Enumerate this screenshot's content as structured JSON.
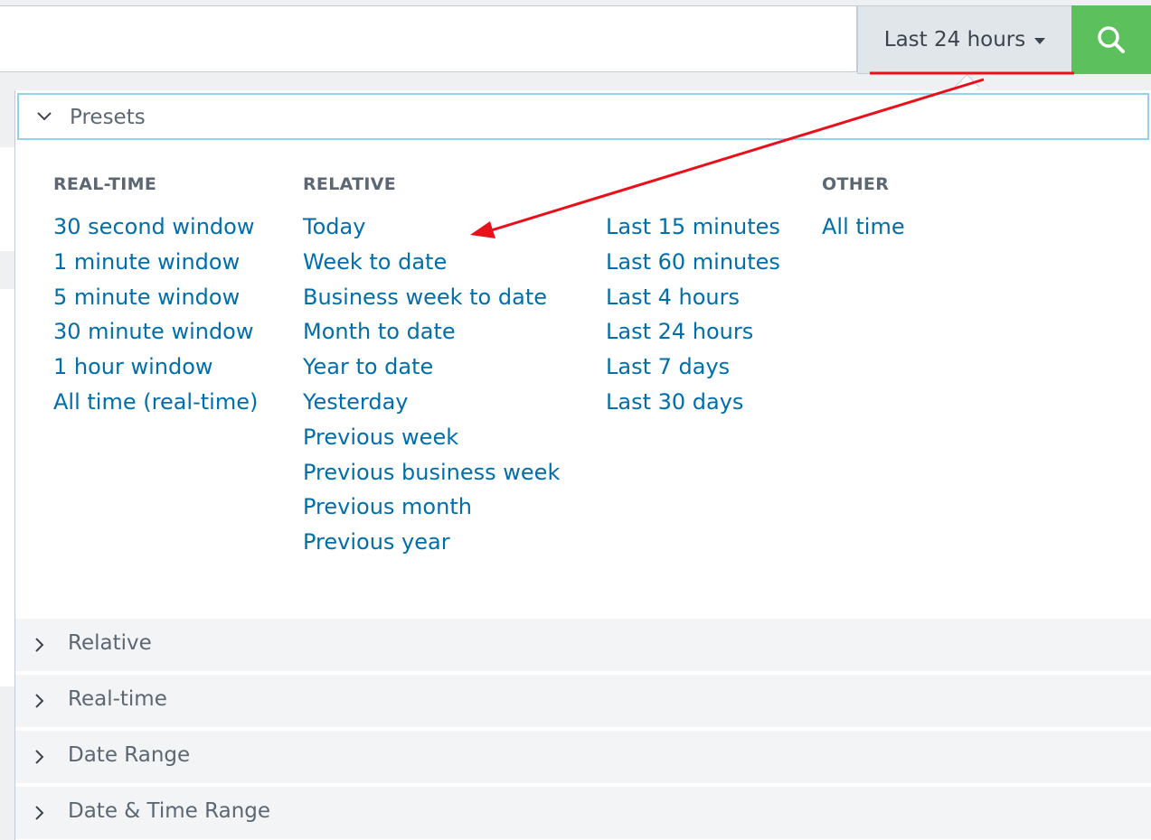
{
  "toolbar": {
    "time_range_label": "Last 24 hours",
    "search_icon": "search-icon",
    "search_button_color": "#5cc05c"
  },
  "presets": {
    "header_label": "Presets",
    "columns": [
      {
        "heading": "REAL-TIME",
        "items": [
          "30 second window",
          "1 minute window",
          "5 minute window",
          "30 minute window",
          "1 hour window",
          "All time (real-time)"
        ]
      },
      {
        "heading": "RELATIVE",
        "items": [
          "Today",
          "Week to date",
          "Business week to date",
          "Month to date",
          "Year to date",
          "Yesterday",
          "Previous week",
          "Previous business week",
          "Previous month",
          "Previous year"
        ]
      },
      {
        "heading": "",
        "items": [
          "Last 15 minutes",
          "Last 60 minutes",
          "Last 4 hours",
          "Last 24 hours",
          "Last 7 days",
          "Last 30 days"
        ]
      },
      {
        "heading": "OTHER",
        "items": [
          "All time"
        ]
      }
    ]
  },
  "sections": [
    "Relative",
    "Real-time",
    "Date Range",
    "Date & Time Range"
  ],
  "colors": {
    "link": "#006eaa",
    "annotation_arrow": "#e8101a"
  }
}
